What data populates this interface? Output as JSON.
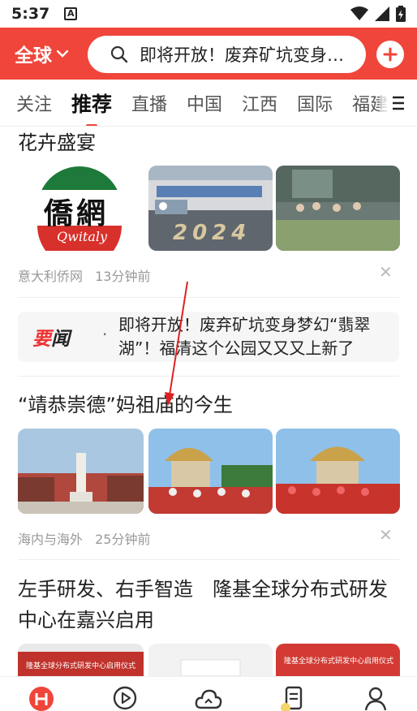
{
  "status_bar": {
    "time": "5:37",
    "notification_letter": "A"
  },
  "header": {
    "region_label": "全球",
    "search_query": "即将开放！废弃矿坑变身梦幻“翡翠湖”",
    "colors": {
      "brand_red": "#f0453a"
    }
  },
  "tabs": [
    {
      "label": "关注"
    },
    {
      "label": "推荐",
      "active": true
    },
    {
      "label": "直播"
    },
    {
      "label": "中国"
    },
    {
      "label": "江西"
    },
    {
      "label": "国际"
    },
    {
      "label": "福建"
    }
  ],
  "feed": {
    "article1": {
      "title": "花卉盛宴",
      "source": "意大利侨网",
      "time": "13分钟前",
      "logo_text": "僑網",
      "logo_sub": "Qwitaly",
      "thumb_banner_text": "2024"
    },
    "headline": {
      "tag_red": "要",
      "tag_black": "闻",
      "text": "即将开放！废弃矿坑变身梦幻“翡翠湖”！福清这个公园又又又上新了"
    },
    "article2": {
      "title": "“靖恭崇德”妈祖庙的今生",
      "source": "海内与海外",
      "time": "25分钟前"
    },
    "article3": {
      "title": "左手研发、右手智造　隆基全球分布式研发中心在嘉兴启用",
      "thumb_captions": [
        "隆基全球分布式研发中心启用仪式",
        "隆基全球分布式研发中心启用仪式"
      ]
    }
  },
  "bottom_nav": [
    {
      "icon": "home-icon",
      "active": true
    },
    {
      "icon": "video-play-icon"
    },
    {
      "icon": "cloud-icon"
    },
    {
      "icon": "news-list-icon"
    },
    {
      "icon": "profile-icon"
    }
  ]
}
